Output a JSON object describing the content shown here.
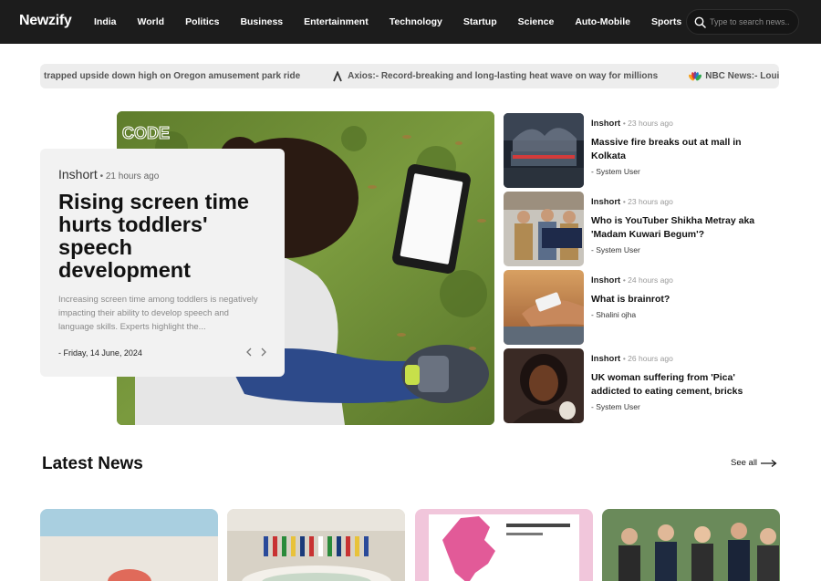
{
  "brand": {
    "logo": "Newzify"
  },
  "nav": {
    "items": [
      "India",
      "World",
      "Politics",
      "Business",
      "Entertainment",
      "Technology",
      "Startup",
      "Science",
      "Auto-Mobile",
      "Sports"
    ]
  },
  "search": {
    "placeholder": "Type to search news..",
    "icon": "search-icon"
  },
  "ticker": {
    "items": [
      {
        "source_icon": "",
        "text": "trapped upside down high on Oregon amusement park ride"
      },
      {
        "source_icon": "axios-logo-icon",
        "text": "Axios:- Record-breaking and long-lasting heat wave on way for millions"
      },
      {
        "source_icon": "nbc-peacock-icon",
        "text": "NBC News:- Louisiana Repu"
      }
    ]
  },
  "hero": {
    "source": "Inshort",
    "time": "• 21 hours ago",
    "title": "Rising screen time hurts toddlers' speech development",
    "description": "Increasing screen time among toddlers is negatively impacting their ability to develop speech and language skills. Experts highlight the...",
    "date": "- Friday, 14 June, 2024",
    "image_watermark": "CODE"
  },
  "side_news": [
    {
      "source": "Inshort",
      "time": "• 23 hours ago",
      "title": "Massive fire breaks out at mall in Kolkata",
      "author": "- System User"
    },
    {
      "source": "Inshort",
      "time": "• 23 hours ago",
      "title": "Who is YouTuber Shikha Metray aka 'Madam Kuwari Begum'?",
      "author": "- System User"
    },
    {
      "source": "Inshort",
      "time": "• 24 hours ago",
      "title": "What is brainrot?",
      "author": "- Shalini ojha"
    },
    {
      "source": "Inshort",
      "time": "• 26 hours ago",
      "title": "UK woman suffering from 'Pica' addicted to eating cement, bricks",
      "author": "- System User"
    }
  ],
  "latest": {
    "heading": "Latest News",
    "see_all": "See all"
  },
  "colors": {
    "nav_bg": "#1c1c1c",
    "ticker_bg": "#ededed",
    "card_bg": "#f2f2f2"
  }
}
